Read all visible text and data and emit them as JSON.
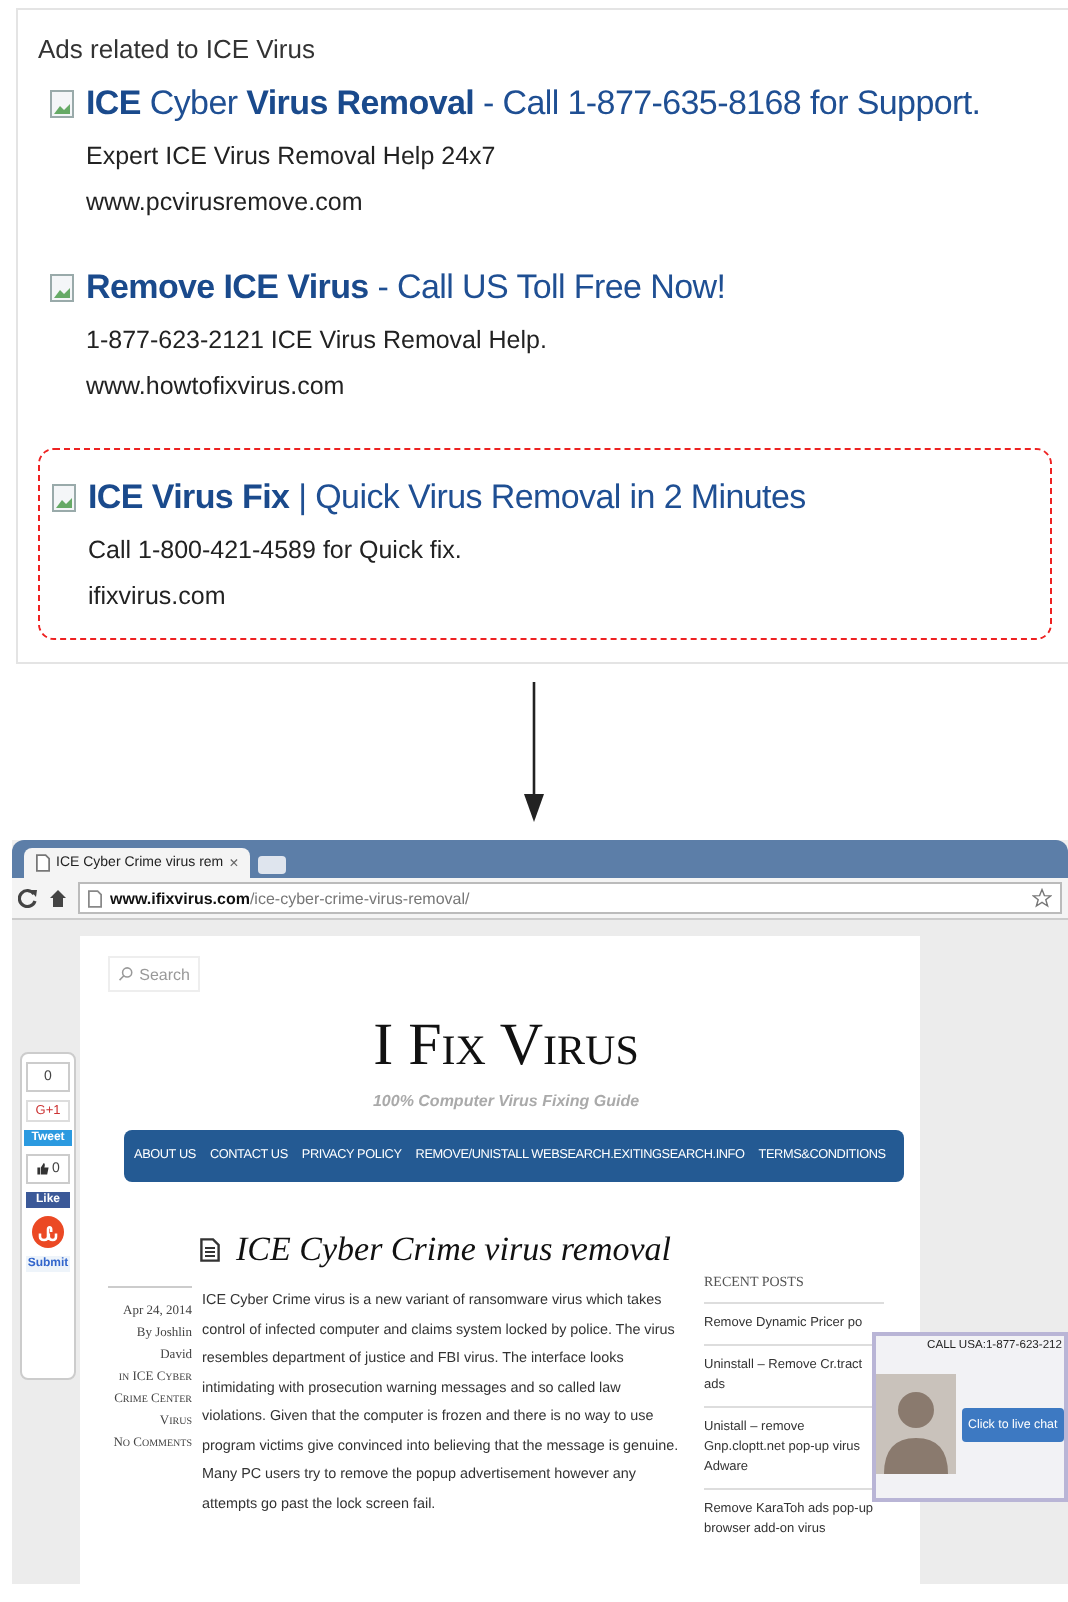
{
  "ads_panel": {
    "heading": "Ads related to ICE Virus",
    "ads": [
      {
        "title": "**ICE** Cyber **Virus Removal** - Call 1-877-635-8168 for Support.",
        "description": "Expert ICE Virus Removal Help 24x7",
        "url": "www.pcvirusremove.com",
        "highlighted": false
      },
      {
        "title": "**Remove ICE Virus** - Call US Toll Free Now!",
        "description": "1-877-623-2121 ICE Virus Removal Help.",
        "url": "www.howtofixvirus.com",
        "highlighted": false
      },
      {
        "title": "**ICE Virus Fix** | Quick Virus Removal in 2 Minutes",
        "description": "Call 1-800-421-4589 for Quick fix.",
        "url": "ifixvirus.com",
        "highlighted": true
      }
    ]
  },
  "browser": {
    "tab": {
      "title": "ICE Cyber Crime virus rem",
      "close": "×"
    },
    "address": "**www.ifixvirus.com**/ice-cyber-crime-virus-removal/",
    "share_bar": {
      "plus_count": "0",
      "plus_label": "G+1",
      "tweet_label": "Tweet",
      "like_count": "0",
      "like_label": "Like",
      "submit_label": "Submit"
    },
    "page": {
      "search": {
        "placeholder": "Search"
      },
      "site_title": "I Fix Virus",
      "tagline": "100% Computer Virus Fixing Guide",
      "nav": [
        "ABOUT US",
        "CONTACT US",
        "PRIVACY POLICY",
        "REMOVE/UNISTALL WEBSEARCH.EXITINGSEARCH.INFO",
        "TERMS&CONDITIONS"
      ],
      "article": {
        "title": "ICE Cyber Crime virus removal",
        "date": "Apr 24, 2014",
        "author": "By Joshlin David",
        "category": "in ICE Cyber Crime Center Virus",
        "comments": "No Comments",
        "body": "ICE Cyber Crime virus is a new variant of ransomware virus which takes control of infected computer and claims system locked by police. The virus resembles department of justice and FBI virus. The interface looks intimidating with prosecution warning messages and so called law violations. Given that the computer is frozen and there is no way to use program victims give convinced into believing that the message is genuine. Many PC users try to remove the popup advertisement however any attempts go past the lock screen fail."
      },
      "recent_posts": {
        "heading": "RECENT POSTS",
        "items": [
          "Remove Dynamic Pricer po",
          "Uninstall – Remove Cr.tract ads",
          "Unistall – remove Gnp.cloptt.net pop-up virus Adware",
          "Remove KaraToh ads pop-up browser add-on virus"
        ]
      },
      "chat_popup": {
        "phone": "CALL USA:1-877-623-212",
        "button": "Click to live chat"
      }
    }
  }
}
